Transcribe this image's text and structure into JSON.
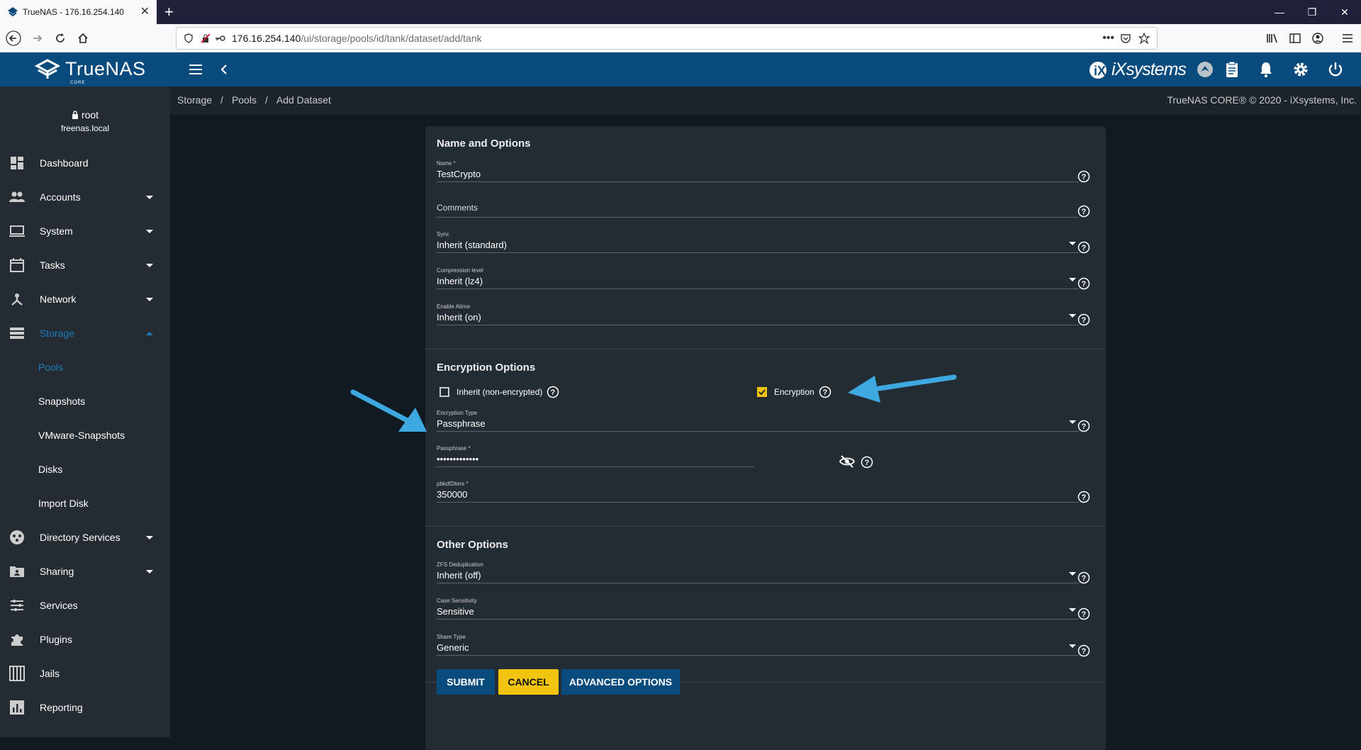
{
  "browser": {
    "tab_title": "TrueNAS - 176.16.254.140",
    "url_host": "176.16.254.140",
    "url_path": "/ui/storage/pools/id/tank/dataset/add/tank"
  },
  "header": {
    "logo_text": "TrueNAS",
    "logo_sub": "CORE",
    "vendor": "iXsystems"
  },
  "sidebar": {
    "user": "root",
    "host": "freenas.local",
    "items": [
      {
        "label": "Dashboard",
        "icon": "dashboard-icon",
        "expand": false
      },
      {
        "label": "Accounts",
        "icon": "accounts-icon",
        "expand": true
      },
      {
        "label": "System",
        "icon": "laptop-icon",
        "expand": true
      },
      {
        "label": "Tasks",
        "icon": "calendar-icon",
        "expand": true
      },
      {
        "label": "Network",
        "icon": "network-icon",
        "expand": true
      },
      {
        "label": "Storage",
        "icon": "storage-icon",
        "expand": true,
        "active": true
      },
      {
        "label": "Pools",
        "sub": true,
        "active": true
      },
      {
        "label": "Snapshots",
        "sub": true
      },
      {
        "label": "VMware-Snapshots",
        "sub": true
      },
      {
        "label": "Disks",
        "sub": true
      },
      {
        "label": "Import Disk",
        "sub": true
      },
      {
        "label": "Directory Services",
        "icon": "directory-icon",
        "expand": true
      },
      {
        "label": "Sharing",
        "icon": "sharing-icon",
        "expand": true
      },
      {
        "label": "Services",
        "icon": "services-icon",
        "expand": false
      },
      {
        "label": "Plugins",
        "icon": "plugins-icon",
        "expand": false
      },
      {
        "label": "Jails",
        "icon": "jails-icon",
        "expand": false
      },
      {
        "label": "Reporting",
        "icon": "reporting-icon",
        "expand": false
      }
    ]
  },
  "breadcrumb": {
    "items": [
      "Storage",
      "Pools",
      "Add Dataset"
    ],
    "copyright": "TrueNAS CORE® © 2020 - iXsystems, Inc."
  },
  "form": {
    "name_options_title": "Name and Options",
    "name": {
      "label": "Name *",
      "value": "TestCrypto"
    },
    "comments": {
      "label": "",
      "placeholder": "Comments"
    },
    "sync": {
      "label": "Sync",
      "value": "Inherit (standard)"
    },
    "compression": {
      "label": "Compression level",
      "value": "Inherit (lz4)"
    },
    "atime": {
      "label": "Enable Atime",
      "value": "Inherit (on)"
    },
    "encryption_title": "Encryption Options",
    "inherit_label": "Inherit (non-encrypted)",
    "encryption_label": "Encryption",
    "enc_type": {
      "label": "Encryption Type",
      "value": "Passphrase"
    },
    "passphrase": {
      "label": "Passphrase *",
      "value": "•••••••••••••"
    },
    "pbkdf2": {
      "label": "pbkdf2iters *",
      "value": "350000"
    },
    "other_title": "Other Options",
    "dedup": {
      "label": "ZFS Deduplication",
      "value": "Inherit (off)"
    },
    "case": {
      "label": "Case Sensitivity",
      "value": "Sensitive"
    },
    "share": {
      "label": "Share Type",
      "value": "Generic"
    },
    "buttons": {
      "submit": "SUBMIT",
      "cancel": "CANCEL",
      "advanced": "ADVANCED OPTIONS"
    }
  },
  "colors": {
    "primary": "#0a4b7d",
    "accent": "#f1c40f",
    "annotation_arrow": "#3ea8e0"
  }
}
